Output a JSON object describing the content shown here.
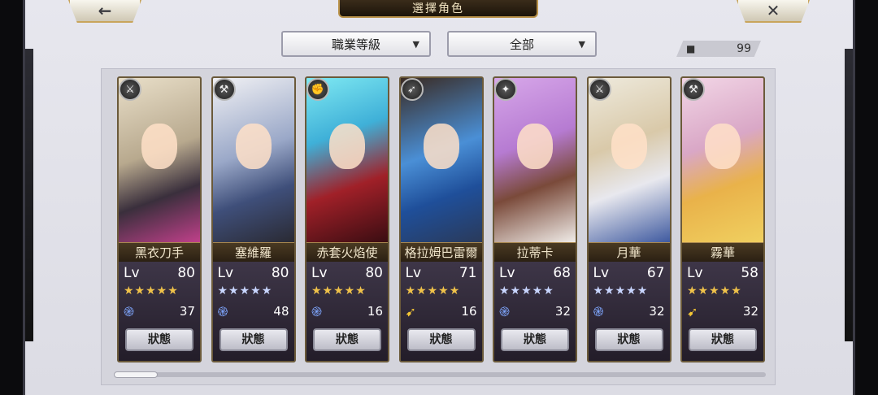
{
  "header": {
    "title": "選擇角色",
    "back_icon": "back-arrow-icon",
    "close_icon": "close-icon"
  },
  "filters": {
    "class_filter": "職業等級",
    "scope_filter": "全部"
  },
  "roster": {
    "count": "99"
  },
  "characters": [
    {
      "name": "黑衣刀手",
      "level_label": "Lv",
      "level": "80",
      "stars": "★★★★★",
      "star_color": "gold",
      "element": "swirl",
      "power": "37",
      "status": "狀態",
      "class_icon": "sword-icon"
    },
    {
      "name": "塞維羅",
      "level_label": "Lv",
      "level": "80",
      "stars": "★★★★★",
      "star_color": "blue",
      "element": "swirl",
      "power": "48",
      "status": "狀態",
      "class_icon": "axe-icon"
    },
    {
      "name": "赤套火焰使",
      "level_label": "Lv",
      "level": "80",
      "stars": "★★★★★",
      "star_color": "gold",
      "element": "swirl",
      "power": "16",
      "status": "狀態",
      "class_icon": "fist-icon"
    },
    {
      "name": "格拉姆巴雷爾",
      "level_label": "Lv",
      "level": "71",
      "stars": "★★★★★",
      "star_color": "gold",
      "element": "wing",
      "power": "16",
      "status": "狀態",
      "class_icon": "arrow-icon"
    },
    {
      "name": "拉蒂卡",
      "level_label": "Lv",
      "level": "68",
      "stars": "★★★★★",
      "star_color": "blue",
      "element": "swirl",
      "power": "32",
      "status": "狀態",
      "class_icon": "magic-icon"
    },
    {
      "name": "月華",
      "level_label": "Lv",
      "level": "67",
      "stars": "★★★★★",
      "star_color": "blue",
      "element": "swirl",
      "power": "32",
      "status": "狀態",
      "class_icon": "sword-icon"
    },
    {
      "name": "霧華",
      "level_label": "Lv",
      "level": "58",
      "stars": "★★★★★",
      "star_color": "gold",
      "element": "wing",
      "power": "32",
      "status": "狀態",
      "class_icon": "hammer-icon"
    }
  ],
  "colors": {
    "accent_gold": "#b9924a",
    "star_gold": "#f0c24a",
    "star_blue": "#c9d6ff"
  }
}
